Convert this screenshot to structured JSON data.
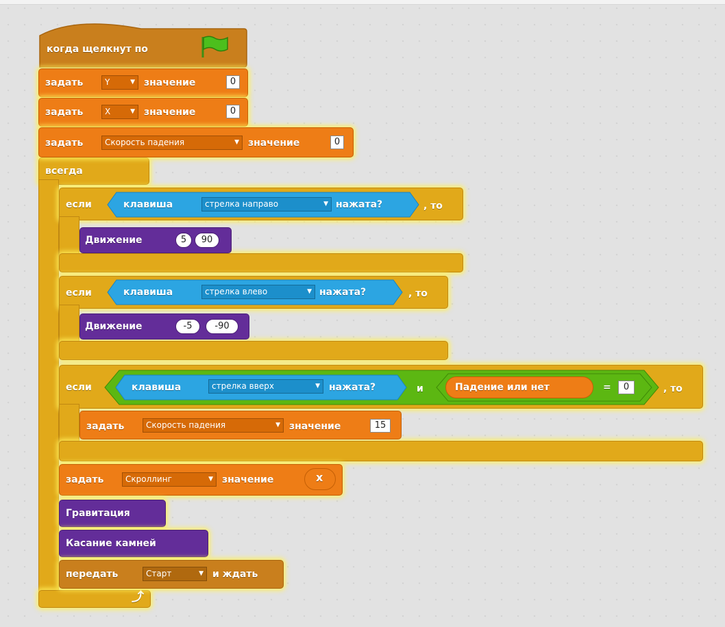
{
  "script": {
    "hat_label": "когда щелкнут по",
    "set_word": "задать",
    "value_word": "значение",
    "var_y": "Y",
    "var_x": "X",
    "var_fall_speed": "Скорость падения",
    "var_scroll": "Скроллинг",
    "val_zero": "0",
    "val_fifteen": "15",
    "forever": "всегда",
    "if_word": "если",
    "then_word": ", то",
    "key_word": "клавиша",
    "pressed_word": "нажата?",
    "key_right": "стрелка направо",
    "key_left": "стрелка влево",
    "key_up": "стрелка вверх",
    "and_word": "и",
    "falling_reporter": "Падение или нет",
    "equals": "=",
    "move_block": "Движение",
    "move_right_a": "5",
    "move_right_b": "90",
    "move_left_a": "-5",
    "move_left_b": "-90",
    "x_reporter": "x",
    "gravity_block": "Гравитация",
    "rocks_block": "Касание камней",
    "broadcast_word": "передать",
    "broadcast_msg": "Старт",
    "and_wait": "и ждать",
    "loop_arrow": "⤴"
  },
  "colors": {
    "events": "#c97f1d",
    "data": "#ee7d16",
    "control": "#e1a91a",
    "sensing": "#2ca5e2",
    "operators": "#5cb712",
    "more_blocks": "#632d99",
    "flag": "#4cbf1d"
  }
}
